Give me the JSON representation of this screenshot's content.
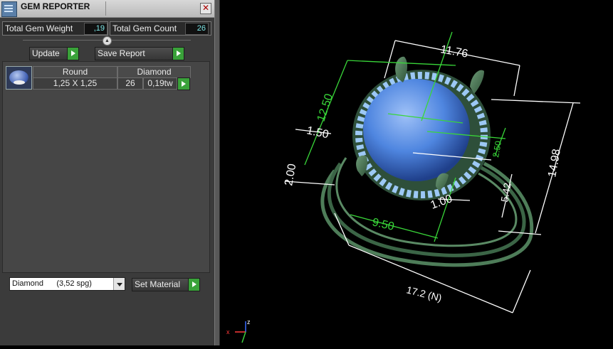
{
  "panel": {
    "title": "GEM REPORTER",
    "close_glyph": "✕",
    "total_weight_label": "Total Gem Weight",
    "total_weight_value": ",19",
    "total_count_label": "Total Gem Count",
    "total_count_value": "26",
    "update_label": "Update",
    "save_report_label": "Save Report",
    "table": {
      "headers": [
        "Round",
        "Diamond"
      ],
      "row": {
        "size": "1,25 X 1,25",
        "count": "26",
        "weight": "0,19tw"
      }
    },
    "material_select_value": "Diamond      (3,52 spg)",
    "set_material_label": "Set Material"
  },
  "viewport": {
    "dimensions": [
      "11.76",
      "12.50",
      "1.50",
      "2.00",
      "2.50",
      "14.98",
      "5.42",
      "1.00",
      "9.50",
      "17.2 (N)"
    ],
    "axis_labels": {
      "x": "x",
      "z": "z"
    },
    "colors": {
      "dimension": "#ffffff",
      "dimension_green": "#39d639",
      "metal": "#3f6b4a",
      "stone": "#4f86e0",
      "accent_stones": "#9cc8f5"
    }
  }
}
